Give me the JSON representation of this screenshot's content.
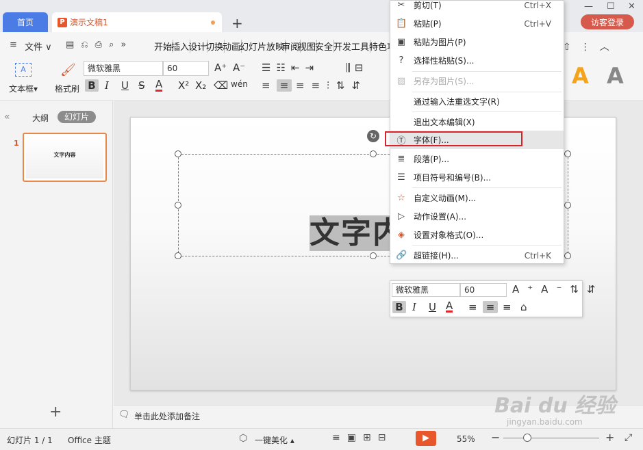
{
  "tabs": {
    "home": "首页",
    "doc": "演示文稿1",
    "add": "+"
  },
  "window": {
    "login": "访客登录"
  },
  "menu": {
    "file": "文件",
    "items": [
      "开始",
      "插入",
      "设计",
      "切换",
      "动画",
      "幻灯片放映",
      "审阅",
      "视图",
      "安全",
      "开发工具",
      "特色功"
    ]
  },
  "ribbon": {
    "textbox": "文本框",
    "formatpainter": "格式刷",
    "font": "微软雅黑",
    "size": "60",
    "bold": "B",
    "italic": "I",
    "underline": "U",
    "strike": "S",
    "fontcolor": "A",
    "sup": "X²",
    "sub": "X₂",
    "style_a1": "A",
    "style_a2": "A"
  },
  "left": {
    "collapse": "«",
    "outline": "大纲",
    "slides": "幻灯片",
    "num": "1",
    "thumb_text": "文字内容",
    "add": "+"
  },
  "slide": {
    "text": "文字内"
  },
  "notes": {
    "placeholder": "单击此处添加备注"
  },
  "status": {
    "slide": "幻灯片 1 / 1",
    "theme": "Office 主题",
    "beautify": "一键美化",
    "zoom": "55%"
  },
  "context_menu": [
    {
      "icon": "✂",
      "label": "剪切(T)",
      "shortcut": "Ctrl+X"
    },
    {
      "icon": "📋",
      "label": "粘贴(P)",
      "shortcut": "Ctrl+V"
    },
    {
      "icon": "▣",
      "label": "粘贴为图片(P)",
      "shortcut": ""
    },
    {
      "icon": "?",
      "label": "选择性粘贴(S)...",
      "shortcut": ""
    },
    {
      "icon": "▨",
      "label": "另存为图片(S)...",
      "shortcut": "",
      "disabled": true
    },
    {
      "icon": "",
      "label": "通过输入法重选文字(R)",
      "shortcut": ""
    },
    {
      "icon": "",
      "label": "退出文本编辑(X)",
      "shortcut": ""
    },
    {
      "icon": "Ⓣ",
      "label": "字体(F)...",
      "shortcut": ""
    },
    {
      "icon": "≣",
      "label": "段落(P)...",
      "shortcut": ""
    },
    {
      "icon": "☰",
      "label": "项目符号和编号(B)...",
      "shortcut": ""
    },
    {
      "icon": "☆",
      "label": "自定义动画(M)...",
      "shortcut": ""
    },
    {
      "icon": "▷",
      "label": "动作设置(A)...",
      "shortcut": ""
    },
    {
      "icon": "◈",
      "label": "设置对象格式(O)...",
      "shortcut": ""
    },
    {
      "icon": "🔗",
      "label": "超链接(H)...",
      "shortcut": "Ctrl+K"
    }
  ],
  "mini_toolbar": {
    "font": "微软雅黑",
    "size": "60"
  },
  "watermark": {
    "main": "Bai du 经验",
    "sub": "jingyan.baidu.com"
  }
}
